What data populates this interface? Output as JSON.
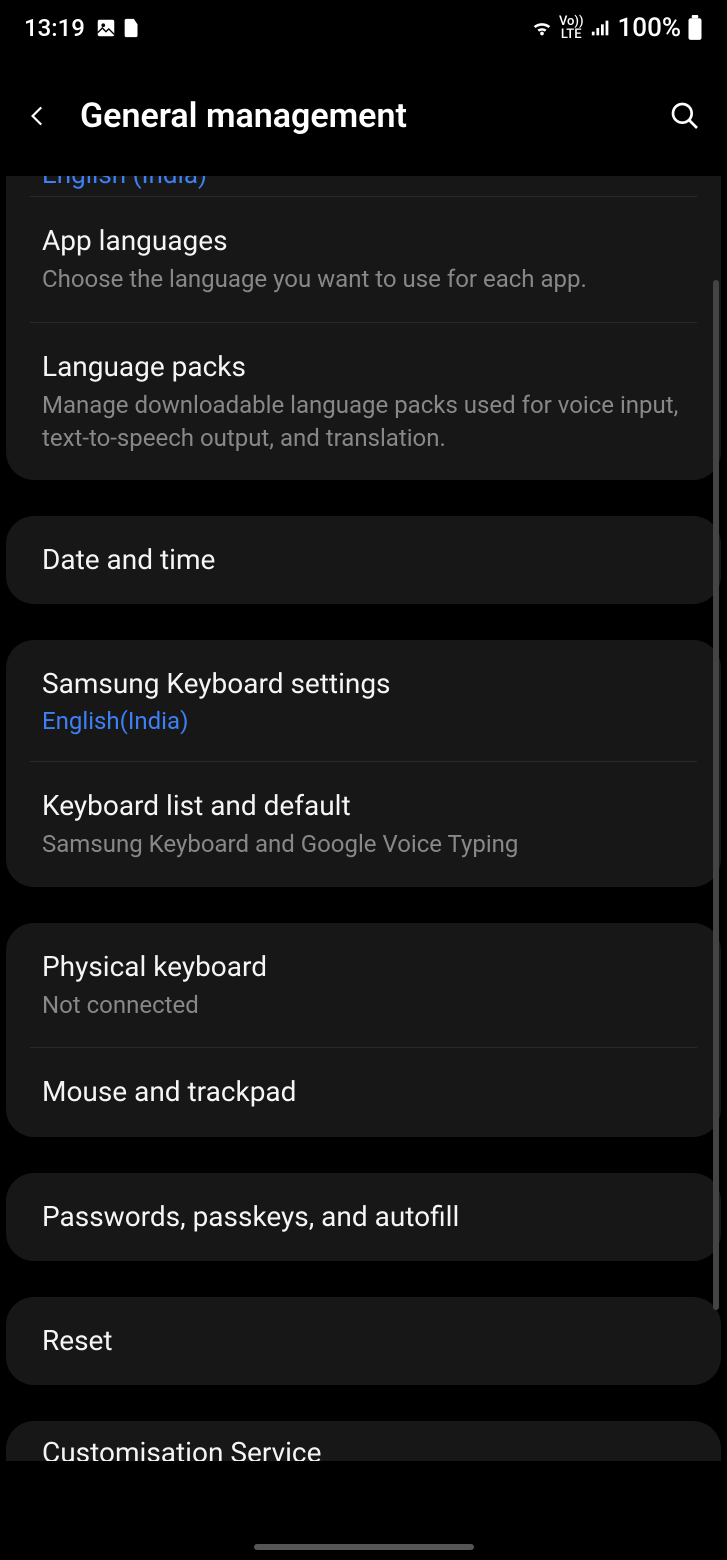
{
  "status": {
    "time": "13:19",
    "battery": "100%"
  },
  "header": {
    "title": "General management"
  },
  "partial_top": {
    "text": "English (India)"
  },
  "groups": [
    {
      "items": [
        {
          "title": "App languages",
          "sub": "Choose the language you want to use for each app."
        },
        {
          "title": "Language packs",
          "sub": "Manage downloadable language packs used for voice input, text-to-speech output, and translation."
        }
      ]
    },
    {
      "items": [
        {
          "title": "Date and time"
        }
      ]
    },
    {
      "items": [
        {
          "title": "Samsung Keyboard settings",
          "sub_blue": "English(India)"
        },
        {
          "title": "Keyboard list and default",
          "sub": "Samsung Keyboard and Google Voice Typing"
        }
      ]
    },
    {
      "items": [
        {
          "title": "Physical keyboard",
          "sub": "Not connected"
        },
        {
          "title": "Mouse and trackpad"
        }
      ]
    },
    {
      "items": [
        {
          "title": "Passwords, passkeys, and autofill"
        }
      ]
    },
    {
      "items": [
        {
          "title": "Reset"
        }
      ]
    }
  ],
  "partial_bottom": {
    "title": "Customisation Service"
  }
}
